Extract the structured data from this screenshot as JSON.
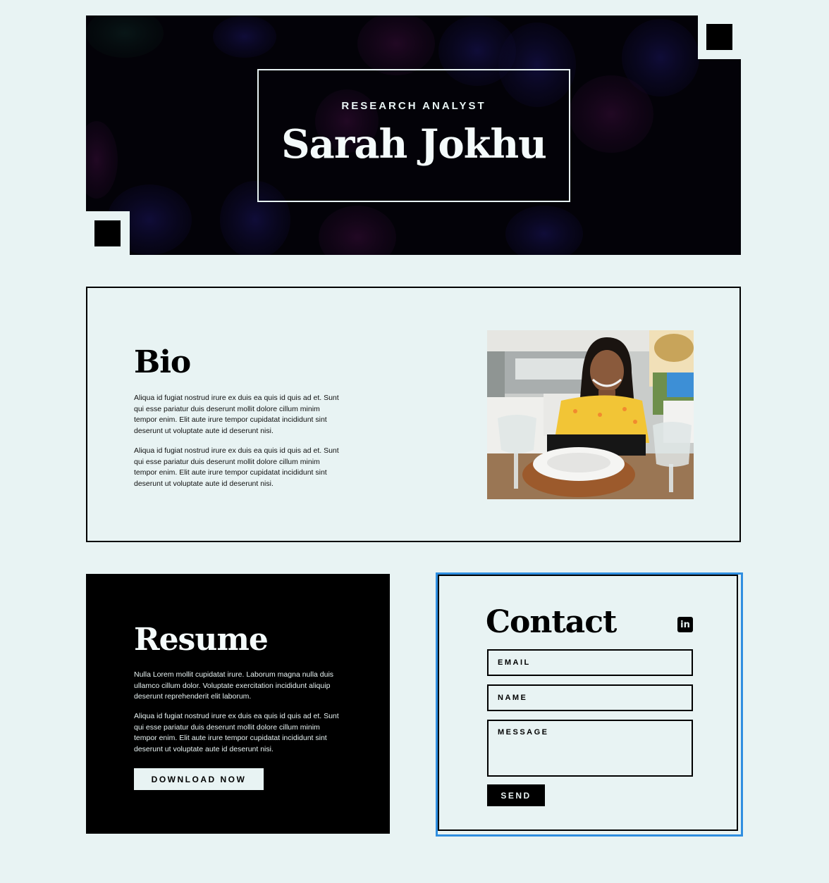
{
  "hero": {
    "subtitle": "RESEARCH ANALYST",
    "name": "Sarah Jokhu"
  },
  "bio": {
    "title": "Bio",
    "paragraphs": [
      "Aliqua id fugiat nostrud irure ex duis ea quis id quis ad et. Sunt qui esse pariatur duis deserunt mollit dolore cillum minim tempor enim. Elit aute irure tempor cupidatat incididunt sint deserunt ut voluptate aute id deserunt nisi.",
      "Aliqua id fugiat nostrud irure ex duis ea quis id quis ad et. Sunt qui esse pariatur duis deserunt mollit dolore cillum minim tempor enim. Elit aute irure tempor cupidatat incididunt sint deserunt ut voluptate aute id deserunt nisi."
    ]
  },
  "resume": {
    "title": "Resume",
    "paragraphs": [
      "Nulla Lorem mollit cupidatat irure. Laborum magna nulla duis ullamco cillum dolor. Voluptate exercitation incididunt aliquip deserunt reprehenderit elit laborum.",
      "Aliqua id fugiat nostrud irure ex duis ea quis id quis ad et. Sunt qui esse pariatur duis deserunt mollit dolore cillum minim tempor enim. Elit aute irure tempor cupidatat incididunt sint deserunt ut voluptate aute id deserunt nisi."
    ],
    "download_label": "DOWNLOAD NOW"
  },
  "contact": {
    "title": "Contact",
    "linkedin_glyph": "in",
    "email_placeholder": "EMAIL",
    "name_placeholder": "NAME",
    "message_placeholder": "MESSAGE",
    "send_label": "SEND"
  },
  "icons": {
    "social": "linkedin-icon"
  },
  "colors": {
    "background": "#e8f3f3",
    "ink": "#000000",
    "focus_outline": "#2f8ee0"
  }
}
